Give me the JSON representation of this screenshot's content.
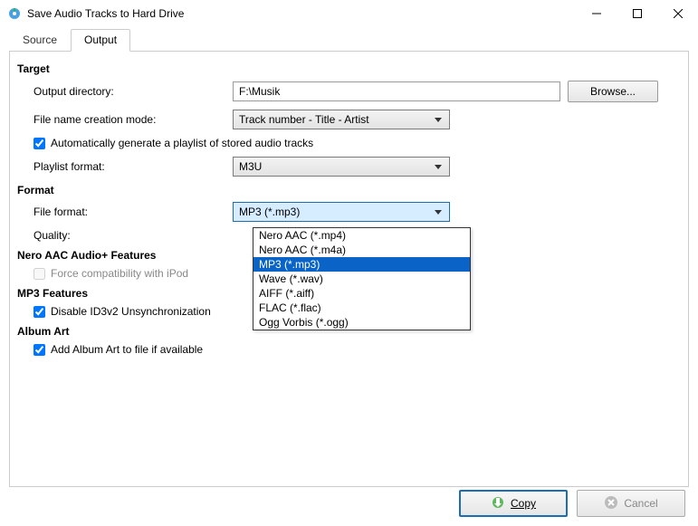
{
  "window": {
    "title": "Save Audio Tracks to Hard Drive"
  },
  "tabs": {
    "source": "Source",
    "output": "Output"
  },
  "target": {
    "heading": "Target",
    "outputDirLabel": "Output directory:",
    "outputDirValue": "F:\\Musik",
    "browse": "Browse...",
    "fileModeLabel": "File name creation mode:",
    "fileModeValue": "Track number - Title - Artist",
    "autoPlaylist": "Automatically generate a playlist of stored audio tracks",
    "playlistFmtLabel": "Playlist format:",
    "playlistFmtValue": "M3U"
  },
  "format": {
    "heading": "Format",
    "fileFormatLabel": "File format:",
    "fileFormatValue": "MP3 (*.mp3)",
    "qualityLabel": "Quality:",
    "options": {
      "o0": "Nero AAC (*.mp4)",
      "o1": "Nero AAC (*.m4a)",
      "o2": "MP3 (*.mp3)",
      "o3": "Wave (*.wav)",
      "o4": "AIFF (*.aiff)",
      "o5": "FLAC (*.flac)",
      "o6": "Ogg Vorbis (*.ogg)"
    }
  },
  "aacFeatures": {
    "heading": "Nero AAC Audio+ Features",
    "ipod": "Force compatibility with iPod"
  },
  "mp3Features": {
    "heading": "MP3 Features",
    "id3": "Disable ID3v2 Unsynchronization"
  },
  "albumArt": {
    "heading": "Album Art",
    "add": "Add Album Art to file if available"
  },
  "footer": {
    "copy": "Copy",
    "cancel": "Cancel"
  }
}
